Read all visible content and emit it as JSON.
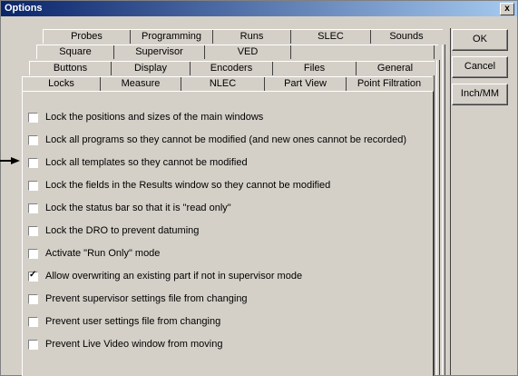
{
  "window": {
    "title": "Options",
    "close_label": "x"
  },
  "tab_rows": [
    [
      "Probes",
      "Programming",
      "Runs",
      "SLEC",
      "Sounds"
    ],
    [
      "Square",
      "Supervisor",
      "VED",
      ""
    ],
    [
      "Buttons",
      "Display",
      "Encoders",
      "Files",
      "General"
    ],
    [
      "Locks",
      "Measure",
      "NLEC",
      "Part View",
      "Point Filtration"
    ]
  ],
  "options": [
    {
      "label": "Lock the positions and sizes of the main windows",
      "checked": false
    },
    {
      "label": "Lock all programs so they cannot be modified (and new ones cannot be recorded)",
      "checked": false
    },
    {
      "label": "Lock all templates so they cannot be modified",
      "checked": false
    },
    {
      "label": "Lock the fields in the Results window so they cannot be modified",
      "checked": false
    },
    {
      "label": "Lock the status bar so that it is \"read only\"",
      "checked": false
    },
    {
      "label": "Lock the DRO to prevent datuming",
      "checked": false
    },
    {
      "label": "Activate \"Run Only\" mode",
      "checked": false
    },
    {
      "label": "Allow overwriting an existing part if not in supervisor mode",
      "checked": true
    },
    {
      "label": "Prevent supervisor settings file from changing",
      "checked": false
    },
    {
      "label": "Prevent user settings file from changing",
      "checked": false
    },
    {
      "label": "Prevent Live Video window from moving",
      "checked": false
    }
  ],
  "buttons": {
    "ok": "OK",
    "cancel": "Cancel",
    "inch_mm": "Inch/MM"
  },
  "check_mark": "✓",
  "colors": {
    "face": "#d4d0c8",
    "title_start": "#0a246a",
    "title_end": "#a6caf0"
  }
}
